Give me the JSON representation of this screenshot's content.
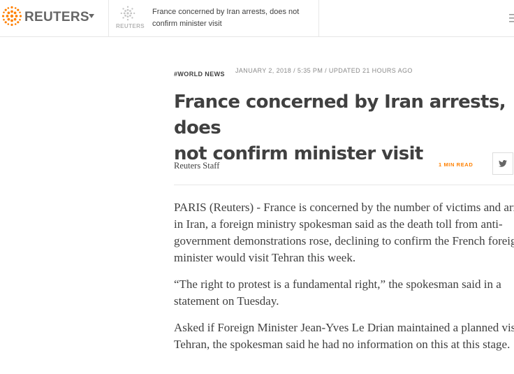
{
  "header": {
    "brand": "REUTERS",
    "story_thumb_text": "REUTERS",
    "story_title": "France concerned by Iran arrests, does not confirm minister visit"
  },
  "article": {
    "channel": "#WORLD NEWS",
    "timestamp": "JANUARY 2, 2018 / 5:35 PM / UPDATED 21 HOURS AGO",
    "headline_lines": [
      "France concerned by Iran arrests, does",
      "not confirm minister visit"
    ],
    "author": "Reuters Staff",
    "read_time": "1 MIN READ",
    "paragraphs": [
      [
        "PARIS (Reuters) - France is concerned by the number of victims and arre",
        "in Iran, a foreign ministry spokesman said as the death toll from anti-",
        "government demonstrations rose, declining to confirm the French foreig",
        "minister would visit Tehran this week."
      ],
      [
        "“The right to protest is a fundamental right,” the spokesman said in a",
        "statement on Tuesday."
      ],
      [
        "Asked if Foreign Minister Jean-Yves Le Drian maintained a planned visit",
        "Tehran, the spokesman said he had no information on this at this stage."
      ]
    ]
  },
  "icons": {
    "logo": "reuters-logo-icon",
    "dropdown": "chevron-down-icon",
    "share": "twitter-icon",
    "menu": "menu-icon"
  },
  "colors": {
    "accent": "#ff8000",
    "text": "#404040",
    "muted": "#8a8a8a",
    "brand_orange": "#ff8000"
  }
}
